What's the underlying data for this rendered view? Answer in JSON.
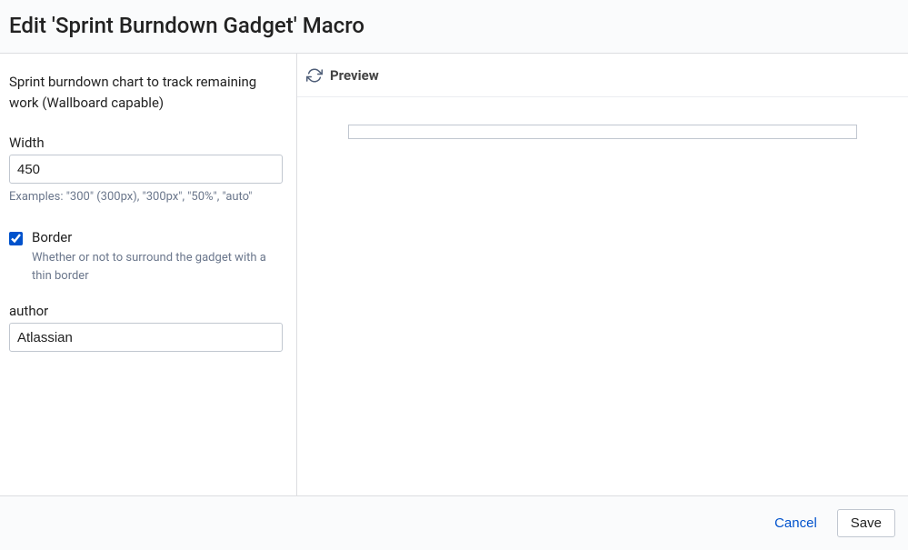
{
  "dialog": {
    "title": "Edit 'Sprint Burndown Gadget' Macro"
  },
  "form": {
    "description": "Sprint burndown chart to track remaining work (Wallboard capable)",
    "width": {
      "label": "Width",
      "value": "450",
      "help": "Examples: \"300\" (300px), \"300px\", \"50%\", \"auto\""
    },
    "border": {
      "label": "Border",
      "checked": true,
      "description": "Whether or not to surround the gadget with a thin border"
    },
    "author": {
      "label": "author",
      "value": "Atlassian"
    }
  },
  "preview": {
    "title": "Preview"
  },
  "footer": {
    "cancel": "Cancel",
    "save": "Save"
  }
}
